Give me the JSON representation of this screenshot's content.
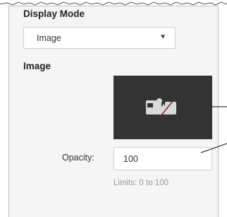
{
  "display_mode": {
    "title": "Display Mode",
    "selected": "Image"
  },
  "image_section": {
    "title": "Image"
  },
  "opacity": {
    "label": "Opacity:",
    "value": "100",
    "limits": "Limits: 0 to 100"
  },
  "icons": {
    "dropdown": "chevron-down-icon",
    "placeholder": "broken-image-icon"
  },
  "colors": {
    "panel_background": "#f5f5f5",
    "preview_background": "#333333",
    "text": "#333333",
    "hint_text": "#9a9a9a"
  }
}
